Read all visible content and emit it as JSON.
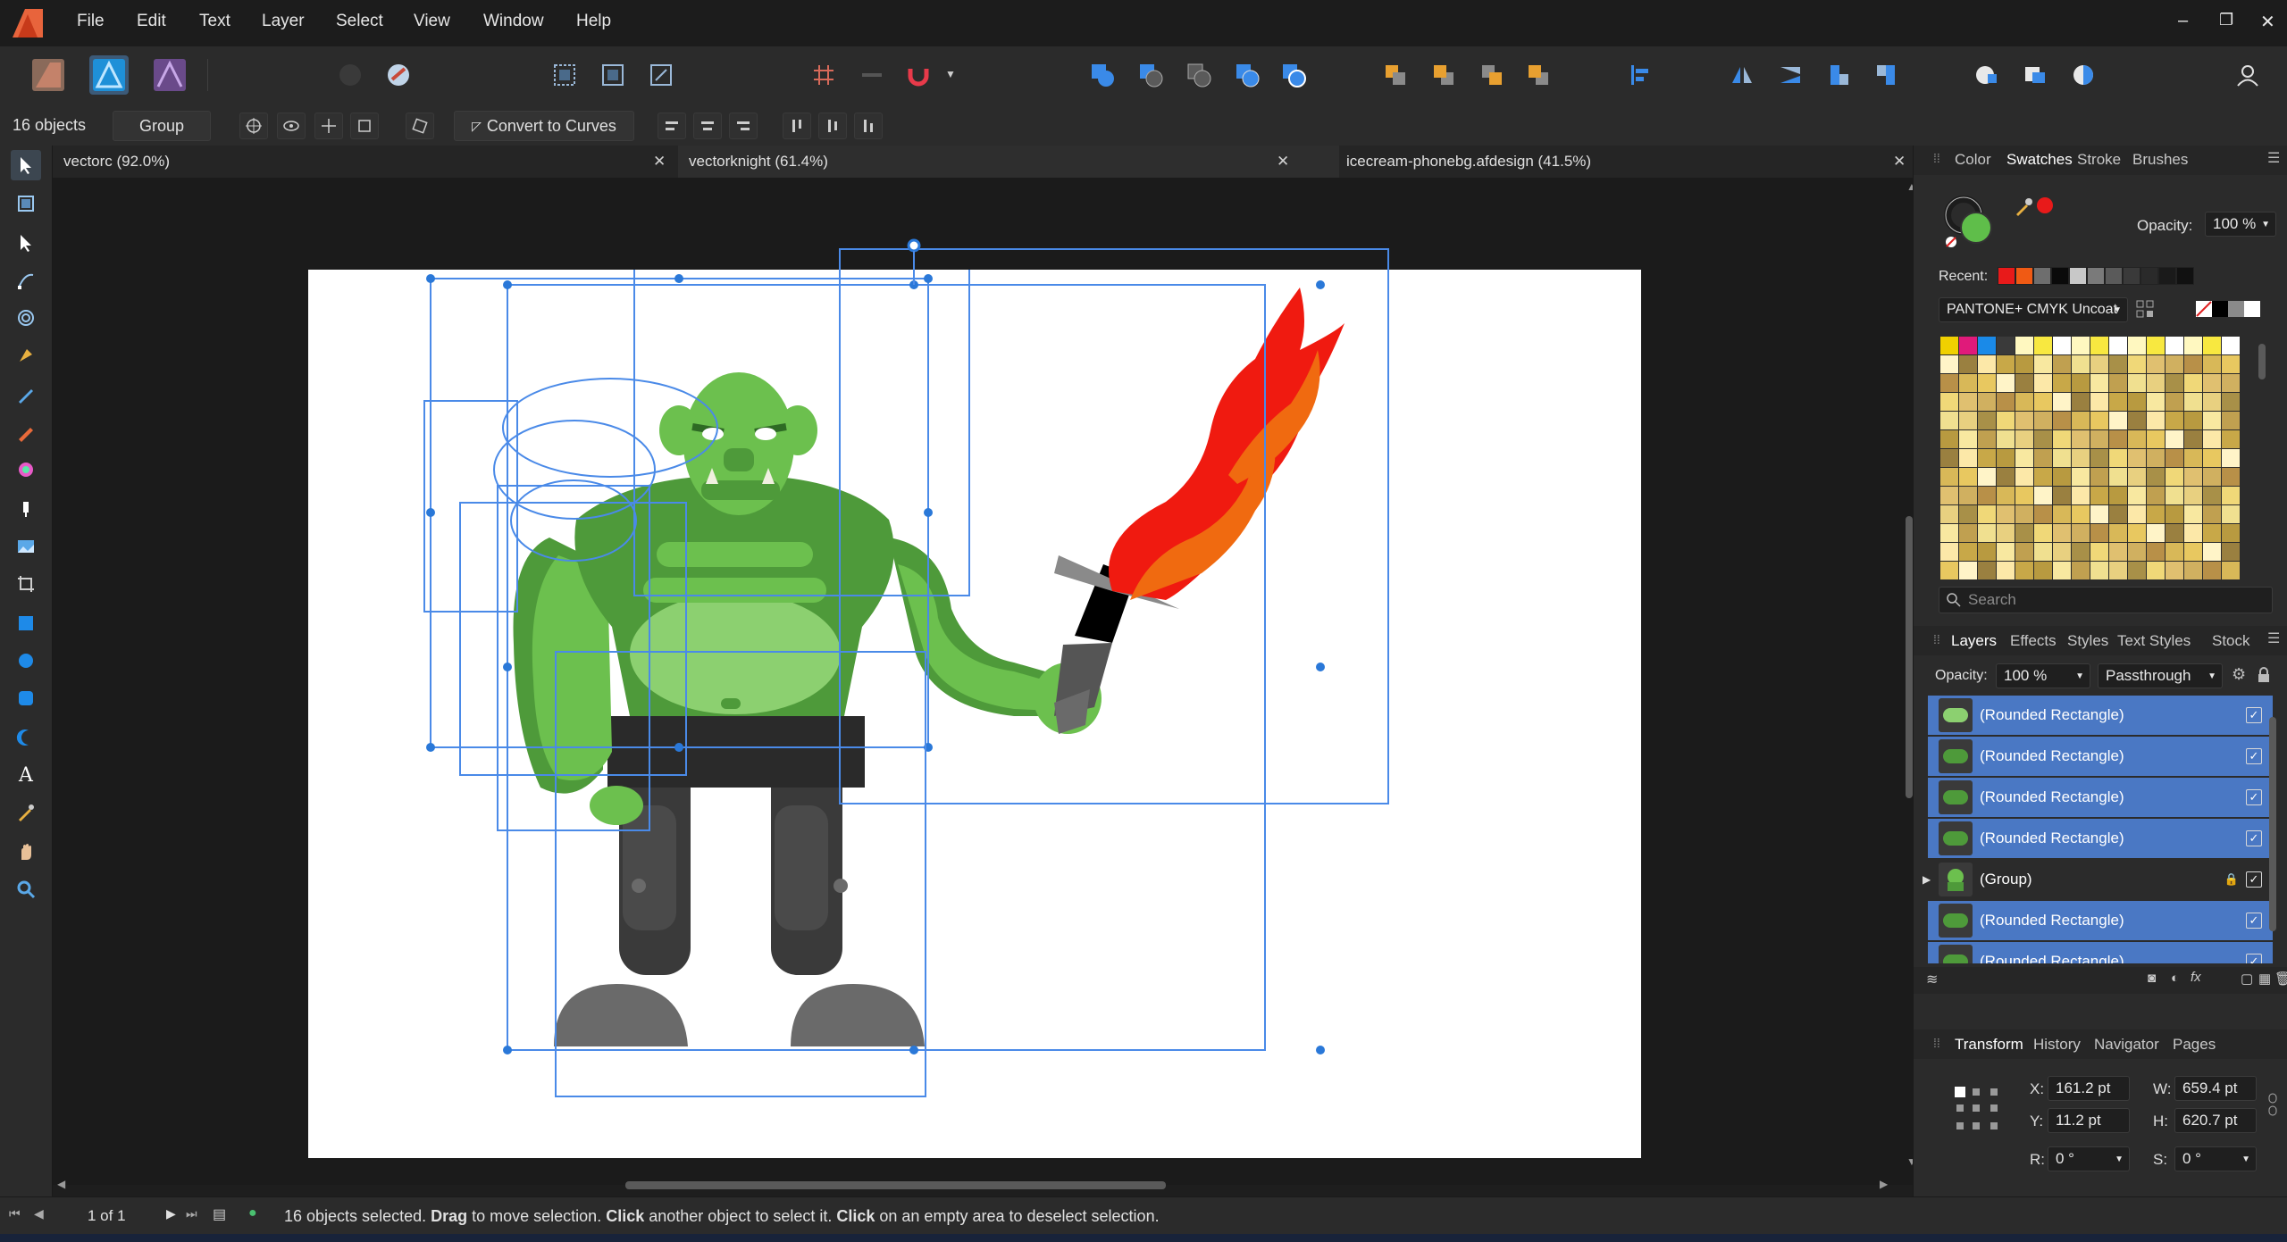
{
  "menu": {
    "items": [
      "File",
      "Edit",
      "Text",
      "Layer",
      "Select",
      "View",
      "Window",
      "Help"
    ],
    "window_controls": {
      "minimize": "–",
      "restore": "❐",
      "close": "✕"
    }
  },
  "context": {
    "selection_count": "16 objects",
    "group_label": "Group",
    "convert_label": "Convert to Curves"
  },
  "tabs": [
    {
      "label": "vectorc (92.0%)",
      "active": false
    },
    {
      "label": "vectorknight (61.4%)",
      "active": true
    },
    {
      "label": "icecream-phonebg.afdesign (41.5%)",
      "active": false
    }
  ],
  "swatches_panel": {
    "tabs": [
      "Color",
      "Swatches",
      "Stroke",
      "Brushes"
    ],
    "active_tab": "Swatches",
    "opacity_label": "Opacity:",
    "opacity_value": "100 %",
    "recent_label": "Recent:",
    "palette_name": "PANTONE+ CMYK Uncoat",
    "search_placeholder": "Search",
    "fill_color": "#5fbe4a",
    "stroke_color": "#1c1c1c",
    "recent_colors": [
      "#e81a1a",
      "#f05a14",
      "#6e6e6e",
      "#0a0a0a",
      "#c8c8c8",
      "#7a7a7a",
      "#5a5a5a",
      "#3a3a3a",
      "#2a2a2a",
      "#1a1a1a",
      "#111111"
    ]
  },
  "layers_panel": {
    "tabs": [
      "Layers",
      "Effects",
      "Styles",
      "Text Styles",
      "Stock"
    ],
    "active_tab": "Layers",
    "opacity_label": "Opacity:",
    "opacity_value": "100 %",
    "blend_mode": "Passthrough",
    "rows": [
      {
        "label": "(Rounded Rectangle)",
        "selected": true
      },
      {
        "label": "(Rounded Rectangle)",
        "selected": true
      },
      {
        "label": "(Rounded Rectangle)",
        "selected": true
      },
      {
        "label": "(Rounded Rectangle)",
        "selected": true
      },
      {
        "label": "(Group)",
        "selected": false
      },
      {
        "label": "(Rounded Rectangle)",
        "selected": true
      },
      {
        "label": "(Rounded Rectangle)",
        "selected": true
      }
    ]
  },
  "transform_panel": {
    "tabs": [
      "Transform",
      "History",
      "Navigator",
      "Pages"
    ],
    "active_tab": "Transform",
    "x_label": "X:",
    "x_value": "161.2 pt",
    "y_label": "Y:",
    "y_value": "11.2 pt",
    "w_label": "W:",
    "w_value": "659.4 pt",
    "h_label": "H:",
    "h_value": "620.7 pt",
    "r_label": "R:",
    "r_value": "0 °",
    "s_label": "S:",
    "s_value": "0 °"
  },
  "status": {
    "page_indicator": "1 of 1",
    "message_parts": [
      "16 objects selected. ",
      "Drag",
      " to move selection. ",
      "Click",
      " another object to select it. ",
      "Click",
      " on an empty area to deselect selection."
    ]
  }
}
